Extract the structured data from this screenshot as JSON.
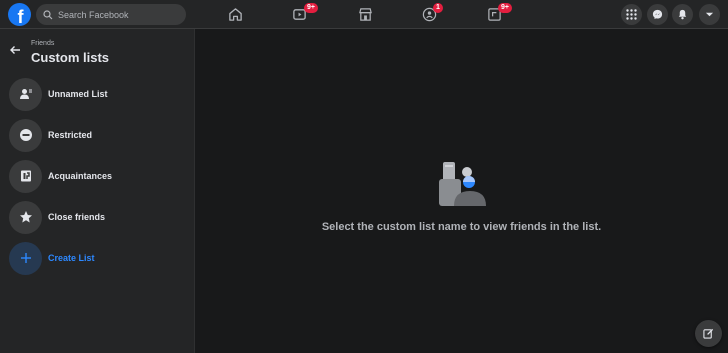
{
  "topbar": {
    "logo_letter": "f",
    "search_placeholder": "Search Facebook",
    "tabs": [
      {
        "name": "home",
        "badge": ""
      },
      {
        "name": "watch",
        "badge": "9+"
      },
      {
        "name": "marketplace",
        "badge": ""
      },
      {
        "name": "groups",
        "badge": "1"
      },
      {
        "name": "gaming",
        "badge": "9+"
      }
    ]
  },
  "sidebar": {
    "breadcrumb": "Friends",
    "title": "Custom lists",
    "items": [
      {
        "label": "Unnamed List",
        "icon": "person-list-icon"
      },
      {
        "label": "Restricted",
        "icon": "restricted-icon"
      },
      {
        "label": "Acquaintances",
        "icon": "acquaintances-icon"
      },
      {
        "label": "Close friends",
        "icon": "star-icon"
      },
      {
        "label": "Create List",
        "icon": "plus-icon"
      }
    ]
  },
  "main": {
    "empty_message": "Select the custom list name to view friends in the list."
  },
  "colors": {
    "accent": "#2d88ff",
    "badge": "#e41e3f",
    "logo": "#1877f2"
  }
}
